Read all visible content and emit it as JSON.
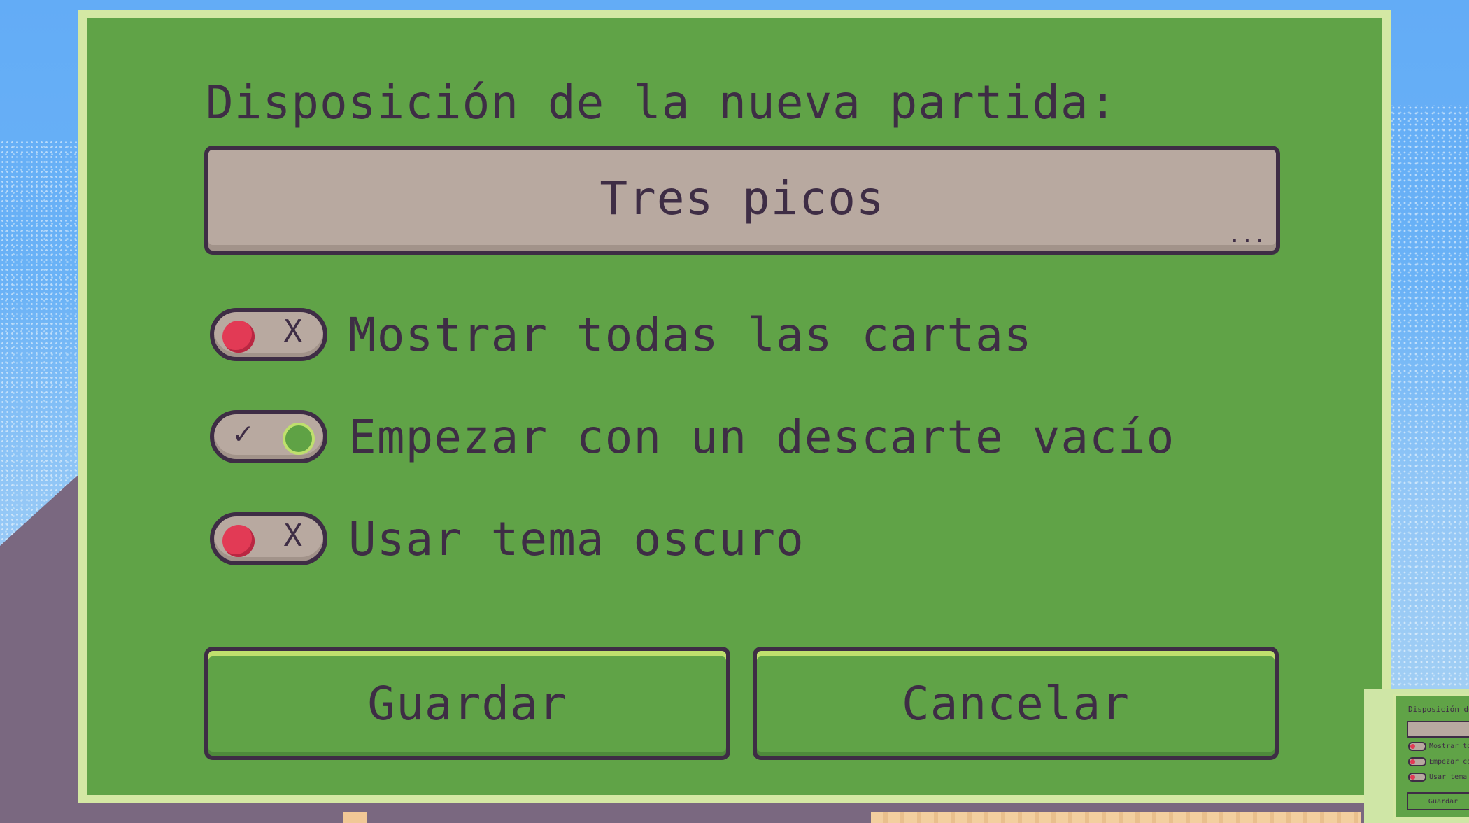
{
  "dialog": {
    "title": "Disposición de la nueva partida:",
    "layout_select": {
      "value": "Tres picos",
      "more_indicator": "..."
    },
    "options": [
      {
        "label": "Mostrar todas las cartas",
        "enabled": false,
        "mark": "X"
      },
      {
        "label": "Empezar con un descarte vacío",
        "enabled": true,
        "mark": "✓"
      },
      {
        "label": "Usar tema oscuro",
        "enabled": false,
        "mark": "X"
      }
    ],
    "buttons": {
      "save_label": "Guardar",
      "cancel_label": "Cancelar"
    }
  },
  "minimap": {
    "title": "Disposición de la nueva partida:",
    "options": [
      "Mostrar todas las cartas",
      "Empezar con un descarte vacío",
      "Usar tema oscuro"
    ],
    "save_label": "Guardar"
  },
  "colors": {
    "panel_green": "#60a347",
    "panel_border": "#d4e8a4",
    "text_dark": "#3e2d45",
    "select_bg": "#b8a9a0",
    "toggle_off_knob": "#e23a55",
    "toggle_on_knob": "#5fa245",
    "sky": "#66aef5",
    "ground": "#7a6880"
  },
  "icons": {
    "off_mark": "x-icon",
    "on_mark": "check-icon",
    "off_knob": "red-dot-icon",
    "on_knob": "green-dot-icon"
  }
}
